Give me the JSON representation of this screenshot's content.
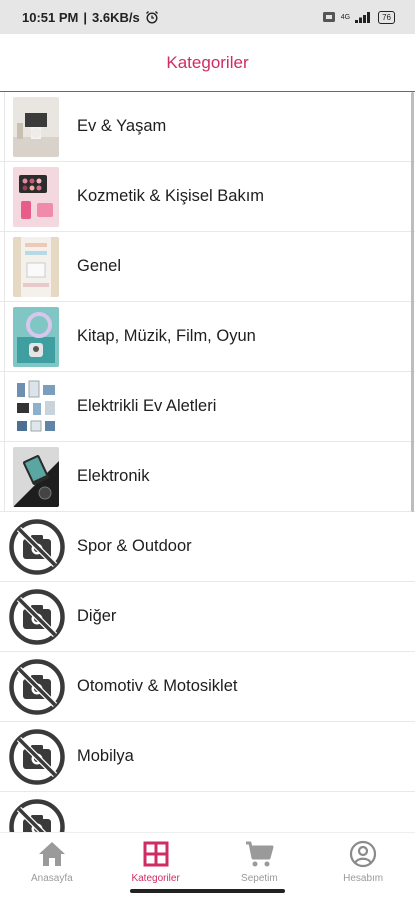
{
  "status_bar": {
    "time": "10:51 PM",
    "speed": "3.6KB/s",
    "network": "4G",
    "battery": "76"
  },
  "header": {
    "title": "Kategoriler"
  },
  "categories": [
    {
      "label": "Ev & Yaşam",
      "image": "photo"
    },
    {
      "label": "Kozmetik & Kişisel Bakım",
      "image": "photo"
    },
    {
      "label": "Genel",
      "image": "photo"
    },
    {
      "label": "Kitap, Müzik, Film, Oyun",
      "image": "photo"
    },
    {
      "label": "Elektrikli Ev Aletleri",
      "image": "photo"
    },
    {
      "label": "Elektronik",
      "image": "photo"
    },
    {
      "label": "Spor & Outdoor",
      "image": "no-photo-icon"
    },
    {
      "label": "Diğer",
      "image": "no-photo-icon"
    },
    {
      "label": "Otomotiv & Motosiklet",
      "image": "no-photo-icon"
    },
    {
      "label": "Mobilya",
      "image": "no-photo-icon"
    },
    {
      "label": "",
      "image": "no-photo-icon"
    }
  ],
  "bottom_nav": {
    "home": "Anasayfa",
    "categories": "Kategoriler",
    "cart": "Sepetim",
    "account": "Hesabım"
  },
  "colors": {
    "accent": "#cf2c63",
    "inactive": "#9a9a9a",
    "no_photo_icon": "#3a3a3a"
  }
}
